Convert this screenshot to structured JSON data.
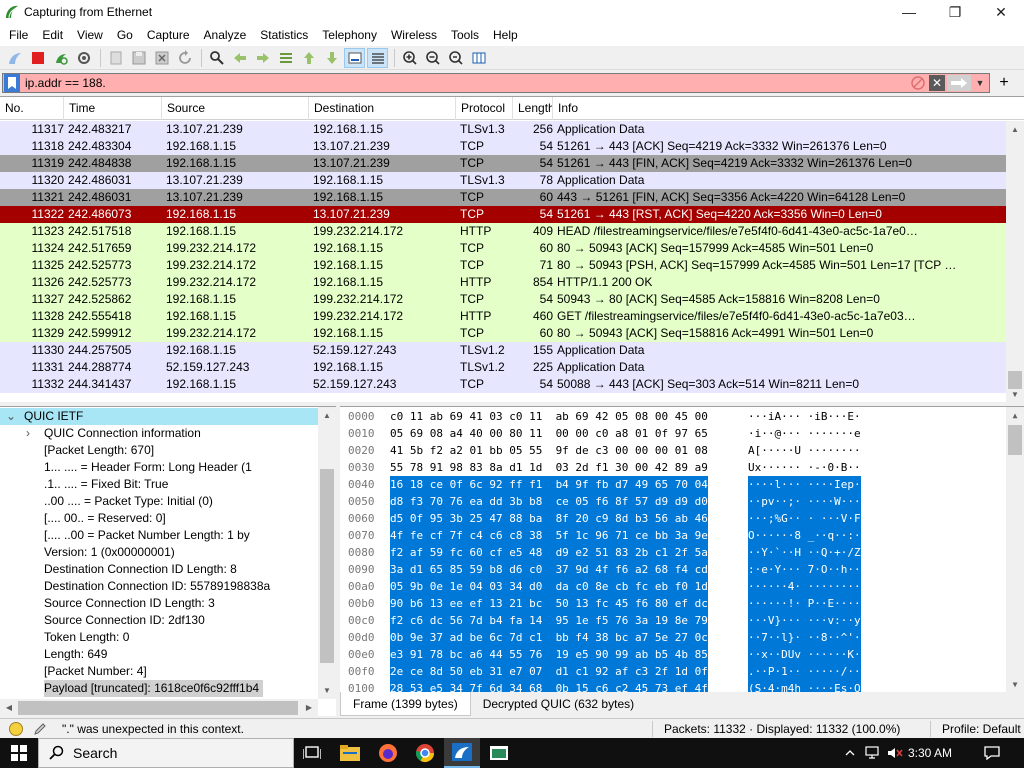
{
  "window": {
    "title": "Capturing from Ethernet",
    "minimize": "—",
    "maximize": "❐",
    "close": "✕"
  },
  "menu": [
    "File",
    "Edit",
    "View",
    "Go",
    "Capture",
    "Analyze",
    "Statistics",
    "Telephony",
    "Wireless",
    "Tools",
    "Help"
  ],
  "filter": {
    "value": "ip.addr == 188.",
    "add_label": "+"
  },
  "packet_list": {
    "columns": [
      "No.",
      "Time",
      "Source",
      "Destination",
      "Protocol",
      "Length",
      "Info"
    ],
    "rows": [
      {
        "no": "11317",
        "time": "242.483217",
        "src": "13.107.21.239",
        "dst": "192.168.1.15",
        "proto": "TLSv1.3",
        "len": "256",
        "info": "Application Data",
        "style": "tls"
      },
      {
        "no": "11318",
        "time": "242.483304",
        "src": "192.168.1.15",
        "dst": "13.107.21.239",
        "proto": "TCP",
        "len": "54",
        "info": "51261 → 443 [ACK] Seq=4219 Ack=3332 Win=261376 Len=0",
        "style": "tls"
      },
      {
        "no": "11319",
        "time": "242.484838",
        "src": "192.168.1.15",
        "dst": "13.107.21.239",
        "proto": "TCP",
        "len": "54",
        "info": "51261 → 443 [FIN, ACK] Seq=4219 Ack=3332 Win=261376 Len=0",
        "style": "fin"
      },
      {
        "no": "11320",
        "time": "242.486031",
        "src": "13.107.21.239",
        "dst": "192.168.1.15",
        "proto": "TLSv1.3",
        "len": "78",
        "info": "Application Data",
        "style": "tls"
      },
      {
        "no": "11321",
        "time": "242.486031",
        "src": "13.107.21.239",
        "dst": "192.168.1.15",
        "proto": "TCP",
        "len": "60",
        "info": "443 → 51261 [FIN, ACK] Seq=3356 Ack=4220 Win=64128 Len=0",
        "style": "fin"
      },
      {
        "no": "11322",
        "time": "242.486073",
        "src": "192.168.1.15",
        "dst": "13.107.21.239",
        "proto": "TCP",
        "len": "54",
        "info": "51261 → 443 [RST, ACK] Seq=4220 Ack=3356 Win=0 Len=0",
        "style": "rst"
      },
      {
        "no": "11323",
        "time": "242.517518",
        "src": "192.168.1.15",
        "dst": "199.232.214.172",
        "proto": "HTTP",
        "len": "409",
        "info": "HEAD /filestreamingservice/files/e7e5f4f0-6d41-43e0-ac5c-1a7e0…",
        "style": "http"
      },
      {
        "no": "11324",
        "time": "242.517659",
        "src": "199.232.214.172",
        "dst": "192.168.1.15",
        "proto": "TCP",
        "len": "60",
        "info": "80 → 50943 [ACK] Seq=157999 Ack=4585 Win=501 Len=0",
        "style": "http"
      },
      {
        "no": "11325",
        "time": "242.525773",
        "src": "199.232.214.172",
        "dst": "192.168.1.15",
        "proto": "TCP",
        "len": "71",
        "info": "80 → 50943 [PSH, ACK] Seq=157999 Ack=4585 Win=501 Len=17 [TCP …",
        "style": "http"
      },
      {
        "no": "11326",
        "time": "242.525773",
        "src": "199.232.214.172",
        "dst": "192.168.1.15",
        "proto": "HTTP",
        "len": "854",
        "info": "HTTP/1.1 200 OK",
        "style": "http"
      },
      {
        "no": "11327",
        "time": "242.525862",
        "src": "192.168.1.15",
        "dst": "199.232.214.172",
        "proto": "TCP",
        "len": "54",
        "info": "50943 → 80 [ACK] Seq=4585 Ack=158816 Win=8208 Len=0",
        "style": "http"
      },
      {
        "no": "11328",
        "time": "242.555418",
        "src": "192.168.1.15",
        "dst": "199.232.214.172",
        "proto": "HTTP",
        "len": "460",
        "info": "GET /filestreamingservice/files/e7e5f4f0-6d41-43e0-ac5c-1a7e03…",
        "style": "http"
      },
      {
        "no": "11329",
        "time": "242.599912",
        "src": "199.232.214.172",
        "dst": "192.168.1.15",
        "proto": "TCP",
        "len": "60",
        "info": "80 → 50943 [ACK] Seq=158816 Ack=4991 Win=501 Len=0",
        "style": "http"
      },
      {
        "no": "11330",
        "time": "244.257505",
        "src": "192.168.1.15",
        "dst": "52.159.127.243",
        "proto": "TLSv1.2",
        "len": "155",
        "info": "Application Data",
        "style": "tls"
      },
      {
        "no": "11331",
        "time": "244.288774",
        "src": "52.159.127.243",
        "dst": "192.168.1.15",
        "proto": "TLSv1.2",
        "len": "225",
        "info": "Application Data",
        "style": "tls"
      },
      {
        "no": "11332",
        "time": "244.341437",
        "src": "192.168.1.15",
        "dst": "52.159.127.243",
        "proto": "TCP",
        "len": "54",
        "info": "50088 → 443 [ACK] Seq=303 Ack=514 Win=8211 Len=0",
        "style": "tls"
      }
    ]
  },
  "details": {
    "lines": [
      {
        "text": "QUIC IETF",
        "indent": 0,
        "arrow": "⌄",
        "selected": true
      },
      {
        "text": "QUIC Connection information",
        "indent": 1,
        "arrow": "›"
      },
      {
        "text": "[Packet Length: 670]",
        "indent": 1
      },
      {
        "text": "1... .... = Header Form: Long Header (1",
        "indent": 1
      },
      {
        "text": ".1.. .... = Fixed Bit: True",
        "indent": 1
      },
      {
        "text": "..00 .... = Packet Type: Initial (0)",
        "indent": 1
      },
      {
        "text": "[.... 00.. = Reserved: 0]",
        "indent": 1
      },
      {
        "text": "[.... ..00 = Packet Number Length: 1 by",
        "indent": 1
      },
      {
        "text": "Version: 1 (0x00000001)",
        "indent": 1
      },
      {
        "text": "Destination Connection ID Length: 8",
        "indent": 1
      },
      {
        "text": "Destination Connection ID: 55789198838a",
        "indent": 1
      },
      {
        "text": "Source Connection ID Length: 3",
        "indent": 1
      },
      {
        "text": "Source Connection ID: 2df130",
        "indent": 1
      },
      {
        "text": "Token Length: 0",
        "indent": 1
      },
      {
        "text": "Length: 649",
        "indent": 1
      },
      {
        "text": "[Packet Number: 4]",
        "indent": 1
      },
      {
        "text": "Payload [truncated]: 1618ce0f6c92fff1b4",
        "indent": 1,
        "highlight": true
      }
    ]
  },
  "bytes": {
    "rows": [
      {
        "off": "0000",
        "hex": "c0 11 ab 69 41 03 c0 11  ab 69 42 05 08 00 45 00",
        "asc": "···iA··· ·iB···E·",
        "hl": false
      },
      {
        "off": "0010",
        "hex": "05 69 08 a4 40 00 80 11  00 00 c0 a8 01 0f 97 65",
        "asc": "·i··@··· ·······e",
        "hl": false
      },
      {
        "off": "0020",
        "hex": "41 5b f2 a2 01 bb 05 55  9f de c3 00 00 00 01 08",
        "asc": "A[·····U ········",
        "hl": false
      },
      {
        "off": "0030",
        "hex": "55 78 91 98 83 8a d1 1d  03 2d f1 30 00 42 89 a9",
        "asc": "Ux······ ·-·0·B··",
        "hl": false
      },
      {
        "off": "0040",
        "hex": "16 18 ce 0f 6c 92 ff f1  b4 9f fb d7 49 65 70 04",
        "asc": "····l··· ····Iep·",
        "hl": true
      },
      {
        "off": "0050",
        "hex": "d8 f3 70 76 ea dd 3b b8  ce 05 f6 8f 57 d9 d9 d0",
        "asc": "··pv··;· ····W···",
        "hl": true
      },
      {
        "off": "0060",
        "hex": "d5 0f 95 3b 25 47 88 ba  8f 20 c9 8d b3 56 ab 46",
        "asc": "···;%G·· · ···V·F",
        "hl": true
      },
      {
        "off": "0070",
        "hex": "4f fe cf 7f c4 c6 c8 38  5f 1c 96 71 ce bb 3a 9e",
        "asc": "O······8 _··q··:·",
        "hl": true
      },
      {
        "off": "0080",
        "hex": "f2 af 59 fc 60 cf e5 48  d9 e2 51 83 2b c1 2f 5a",
        "asc": "··Y·`··H ··Q·+·/Z",
        "hl": true
      },
      {
        "off": "0090",
        "hex": "3a d1 65 85 59 b8 d6 c0  37 9d 4f f6 a2 68 f4 cd",
        "asc": ":·e·Y··· 7·O··h··",
        "hl": true
      },
      {
        "off": "00a0",
        "hex": "05 9b 0e 1e 04 03 34 d0  da c0 8e cb fc eb f0 1d",
        "asc": "······4· ········",
        "hl": true
      },
      {
        "off": "00b0",
        "hex": "90 b6 13 ee ef 13 21 bc  50 13 fc 45 f6 80 ef dc",
        "asc": "······!· P··E····",
        "hl": true
      },
      {
        "off": "00c0",
        "hex": "f2 c6 dc 56 7d b4 fa 14  95 1e f5 76 3a 19 8e 79",
        "asc": "···V}··· ···v:··y",
        "hl": true
      },
      {
        "off": "00d0",
        "hex": "0b 9e 37 ad be 6c 7d c1  bb f4 38 bc a7 5e 27 0c",
        "asc": "··7··l}· ··8··^'·",
        "hl": true
      },
      {
        "off": "00e0",
        "hex": "e3 91 78 bc a6 44 55 76  19 e5 90 99 ab b5 4b 85",
        "asc": "··x··DUv ······K·",
        "hl": true
      },
      {
        "off": "00f0",
        "hex": "2e ce 8d 50 eb 31 e7 07  d1 c1 92 af c3 2f 1d 0f",
        "asc": ".··P·1·· ·····/··",
        "hl": true
      },
      {
        "off": "0100",
        "hex": "28 53 e5 34 7f 6d 34 68  0b 15 c6 c2 45 73 ef 4f",
        "asc": "(S·4·m4h ····Es·O",
        "hl": true
      },
      {
        "off": "0110",
        "hex": "86 de 87 02 13 2a 67 fa  f4 14 f0 fd 7d 92 74 f9",
        "asc": "·····*g· ····}·t·",
        "hl": true
      }
    ]
  },
  "byte_tabs": [
    "Frame (1399 bytes)",
    "Decrypted QUIC (632 bytes)"
  ],
  "status": {
    "message": "\".\" was unexpected in this context.",
    "packets": "Packets: 11332 · Displayed: 11332 (100.0%)",
    "profile": "Profile: Default"
  },
  "taskbar": {
    "search": "Search",
    "clock": "3:30 AM"
  },
  "colors": {
    "tls": "#e7e6ff",
    "http": "#e4ffc7",
    "fin": "#a0a0a0",
    "rst": "#a40000",
    "filter_error": "#ffafaf",
    "selection": "#0078d7"
  }
}
